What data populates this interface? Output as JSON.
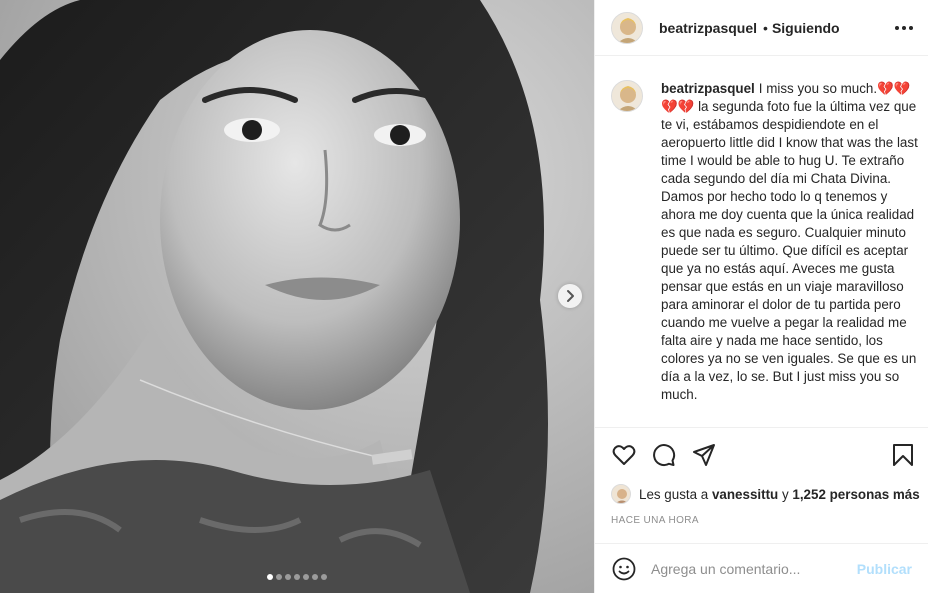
{
  "post": {
    "username": "beatrizpasquel",
    "separator": "•",
    "follow_status": "Siguiendo",
    "more_icon": "more-horizontal-icon",
    "image": {
      "description_icon": "portrait-photo",
      "carousel_count": 7,
      "carousel_active": 1
    },
    "caption": {
      "username": "beatrizpasquel",
      "text": "I miss you so much.💔💔\n💔💔 la segunda foto fue la última vez que te vi, estábamos despidiendote en el aeropuerto little did I know that was the last time I would be able to hug U. Te extraño cada segundo del día mi Chata Divina.\nDamos por hecho todo lo q tenemos y ahora me doy cuenta que la única realidad es que nada es seguro. Cualquier minuto puede ser tu último. Que difícil es aceptar que ya no estás aquí. Aveces me gusta pensar que estás en un viaje maravilloso para aminorar el dolor de tu partida pero cuando me vuelve a pegar la realidad me falta aire y nada me hace sentido, los colores ya no se ven iguales. Se que es un día a la vez, lo se. But I just miss you so much."
    },
    "actions": {
      "like_icon": "heart-icon",
      "comment_icon": "comment-icon",
      "share_icon": "share-icon",
      "save_icon": "bookmark-icon"
    },
    "likes": {
      "prefix": "Les gusta a",
      "liker": "vanessittu",
      "joiner": "y",
      "count_text": "1,252 personas más"
    },
    "timestamp": "Hace una hora",
    "comment": {
      "placeholder": "Agrega un comentario...",
      "publish_label": "Publicar",
      "emoji_icon": "smile-icon"
    }
  },
  "colors": {
    "border": "#efefef",
    "muted": "#8e8e8e",
    "publish_disabled": "#b2dffc",
    "text": "#262626"
  }
}
